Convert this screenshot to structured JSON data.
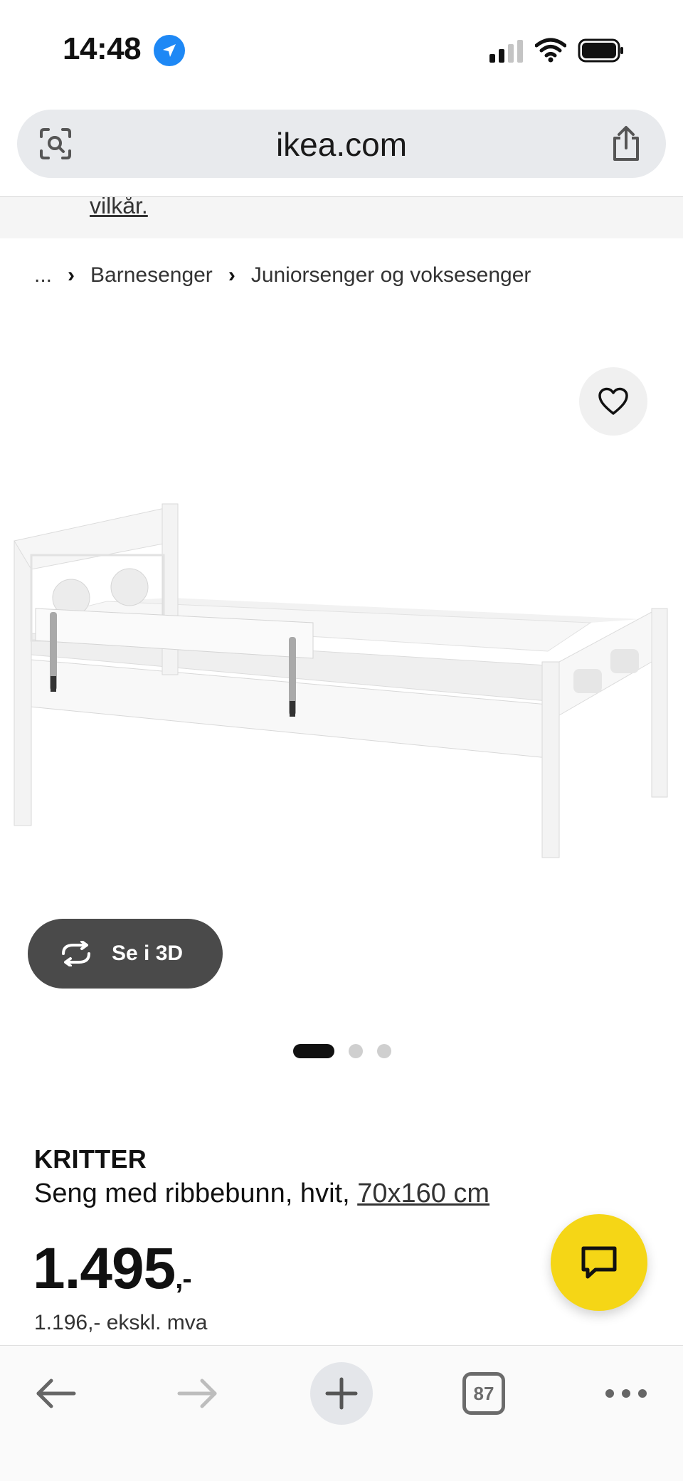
{
  "status_bar": {
    "time": "14:48"
  },
  "browser": {
    "address": "ikea.com"
  },
  "page": {
    "terms_link": "vilkår.",
    "breadcrumb": {
      "ellipsis": "...",
      "items": [
        "Barnesenger",
        "Juniorsenger og voksesenger"
      ]
    },
    "view_3d_label": "Se i 3D",
    "carousel": {
      "total": 3,
      "active": 1
    },
    "product": {
      "brand": "KRITTER",
      "description": "Seng med ribbebunn, hvit, ",
      "size": "70x160 cm",
      "price": "1.495",
      "price_suffix": ",-",
      "price_ex_vat": "1.196,- ekskl. mva"
    }
  },
  "toolbar": {
    "tab_count": "87"
  },
  "colors": {
    "chat_fab": "#f5d616",
    "view_3d_bg": "#4a4a4a",
    "location_blue": "#1e88f5"
  }
}
